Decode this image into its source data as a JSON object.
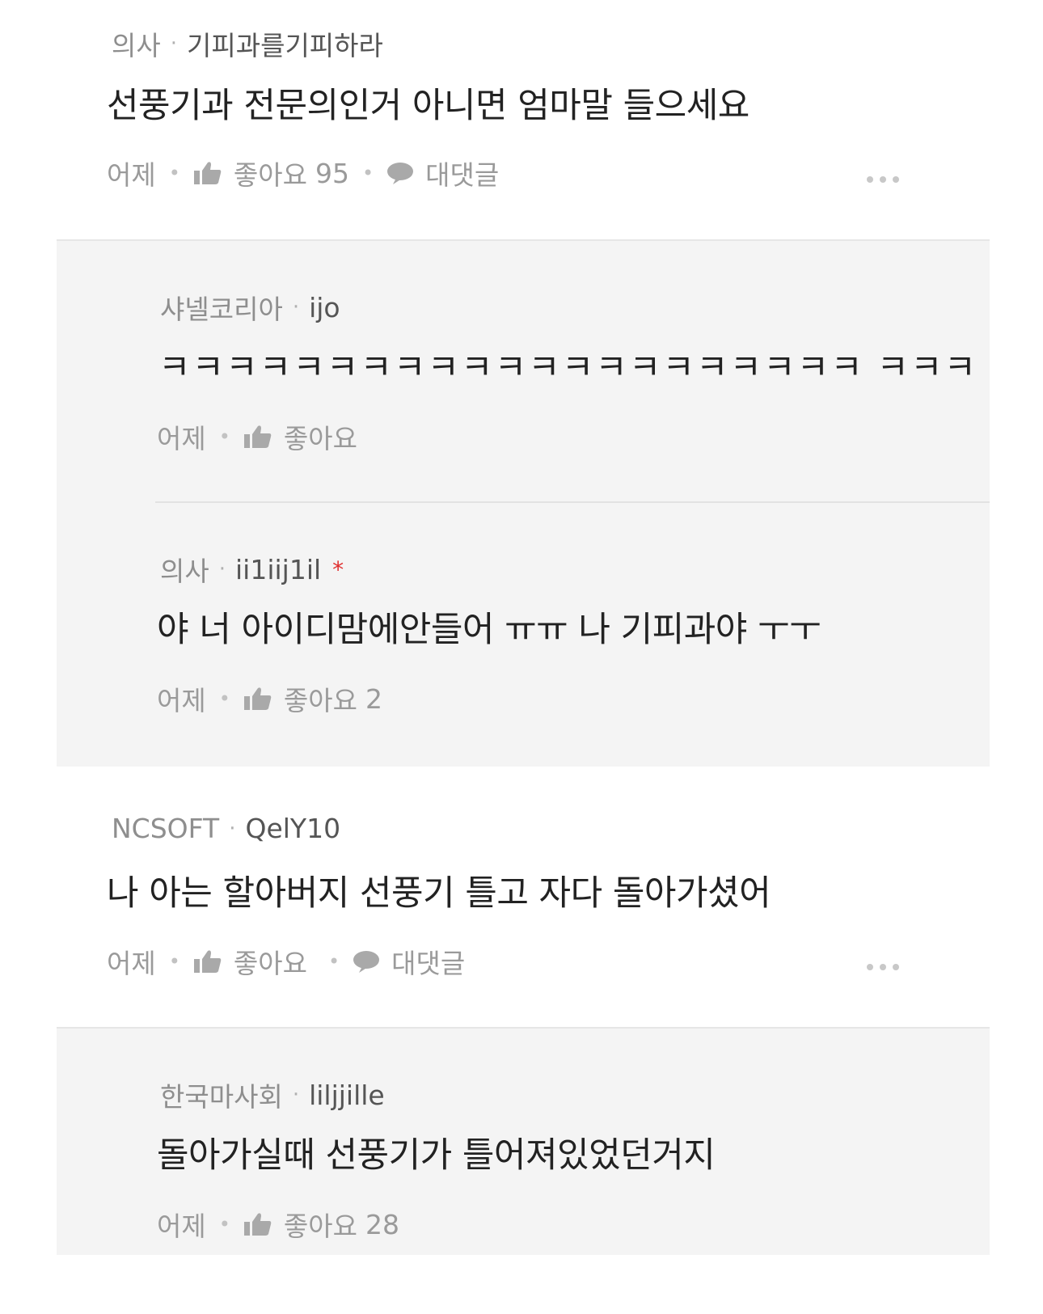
{
  "comments": [
    {
      "org": "의사",
      "nick": "기피과를기피하라",
      "text": "선풍기과 전문의인거 아니면 엄마말 들으세요",
      "time": "어제",
      "like_label": "좋아요",
      "like_count": "95",
      "reply_label": "대댓글"
    },
    {
      "org": "NCSOFT",
      "nick": "QelY10",
      "text": "나 아는 할아버지 선풍기 틀고 자다 돌아가셨어",
      "time": "어제",
      "like_label": "좋아요",
      "like_count": "",
      "reply_label": "대댓글"
    }
  ],
  "replies": [
    {
      "org": "샤넬코리아",
      "nick": "ijo",
      "text": "ㅋㅋㅋㅋㅋㅋㅋㅋㅋㅋㅋㅋㅋㅋㅋㅋㅋㅋㅋㅋㅋ ㅋㅋㅋ",
      "time": "어제",
      "like_label": "좋아요",
      "like_count": ""
    },
    {
      "org": "의사",
      "nick": "ii1iij1il",
      "author_mark": "*",
      "text": "야 너 아이디맘에안들어 ㅠㅠ 나 기피과야 ㅜㅜ",
      "time": "어제",
      "like_label": "좋아요",
      "like_count": "2"
    },
    {
      "org": "한국마사회",
      "nick": "liljjille",
      "text": "돌아가실때 선풍기가 틀어져있었던거지",
      "time": "어제",
      "like_label": "좋아요",
      "like_count": "28"
    }
  ],
  "icons": {
    "like": "thumbs-up-icon",
    "reply": "speech-bubble-icon",
    "more": "more-dots-icon"
  },
  "colors": {
    "reply_bg": "#f4f4f4",
    "meta_text": "#8a8a8a",
    "body_text": "#222222",
    "author_mark": "#e03030"
  }
}
